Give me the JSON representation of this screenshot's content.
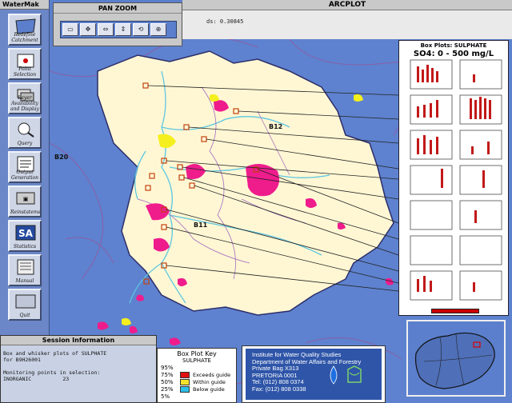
{
  "arcplot": {
    "title": "ARCPLOT",
    "status": "ds: 0.30845"
  },
  "watermaker": {
    "title": "WaterMak",
    "buttons": [
      {
        "label": "Redefine Catchment",
        "icon": "catchment-icon"
      },
      {
        "label": "Point Selection",
        "icon": "point-selection-icon"
      },
      {
        "label": "Layer Availability and Display",
        "icon": "layers-icon"
      },
      {
        "label": "Query",
        "icon": "query-icon"
      },
      {
        "label": "Output Generation",
        "icon": "output-icon"
      },
      {
        "label": "Reinstatement",
        "icon": "reinstate-icon"
      },
      {
        "label": "Statistics",
        "icon": "statistics-icon"
      },
      {
        "label": "Manual",
        "icon": "manual-icon"
      },
      {
        "label": "Quit",
        "icon": "quit-icon"
      }
    ],
    "sa_text": "SA"
  },
  "pan_zoom": {
    "title": "PAN ZOOM",
    "tools": [
      {
        "glyph": "▭",
        "icon": "zoom-window-icon"
      },
      {
        "glyph": "✥",
        "icon": "pan-icon"
      },
      {
        "glyph": "⇔",
        "icon": "zoom-in-icon"
      },
      {
        "glyph": "⇕",
        "icon": "zoom-out-icon"
      },
      {
        "glyph": "⟲",
        "icon": "previous-extent-icon"
      },
      {
        "glyph": "⊕",
        "icon": "full-extent-icon"
      }
    ]
  },
  "box_plots": {
    "title": "Box Plots: SULPHATE",
    "subtitle": "SO4: 0 - 500 mg/L"
  },
  "map_labels": {
    "b12": "B12",
    "b20": "B20",
    "b11": "B11"
  },
  "session": {
    "title": "Session Information",
    "line1": "Box and whisker plots of SULPHATE",
    "line2": "for B9H26001",
    "line3": "Monitoring points in selection:",
    "line4": "INORGANIC          23"
  },
  "key": {
    "title": "Box Plot Key",
    "subtitle": "SULPHATE",
    "pct95": "95%",
    "pct75": "75%",
    "pct50": "50%",
    "pct25": "25%",
    "pct5": "5%",
    "exceeds": "Exceeds guide",
    "within": "Within guide",
    "below": "Below guide",
    "colors": {
      "exceeds": "#e01010",
      "within": "#f6e22a",
      "below": "#2cc0e8"
    }
  },
  "institute": {
    "line1": "Institute for Water Quality Studies",
    "line2": "Department of Water Affairs and Forestry",
    "line3": "Private Bag X313",
    "line4": "PRETORIA 0001",
    "line5": "Tel: (012) 808 0374",
    "line6": "Fax: (012) 808 0338"
  }
}
